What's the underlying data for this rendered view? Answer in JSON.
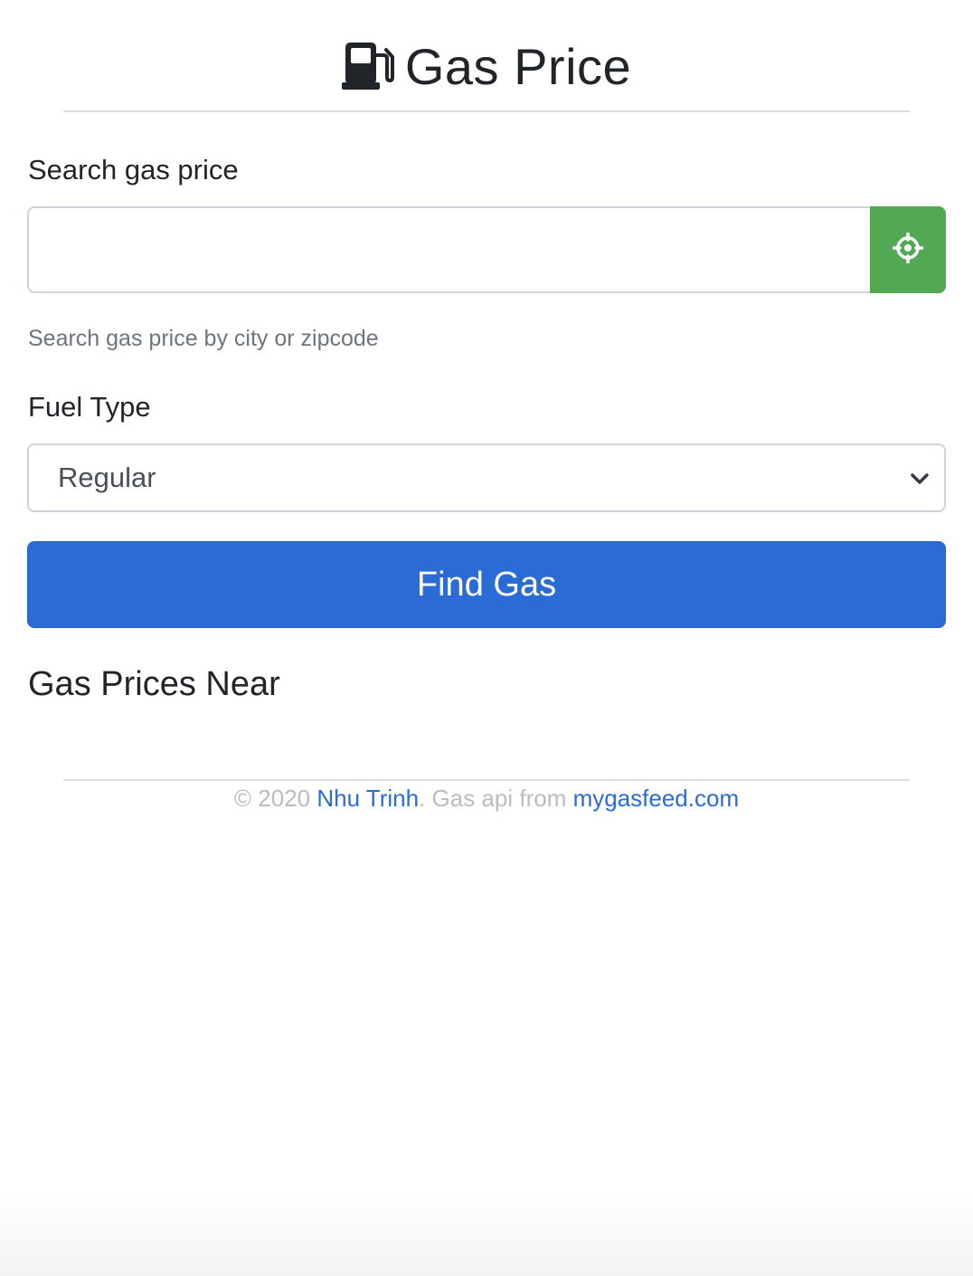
{
  "header": {
    "icon": "gas-pump-icon",
    "title": "Gas Price"
  },
  "search": {
    "label": "Search gas price",
    "value": "",
    "placeholder": "",
    "help_text": "Search gas price by city or zipcode",
    "locate_icon": "crosshairs-icon"
  },
  "fuel": {
    "label": "Fuel Type",
    "selected": "Regular"
  },
  "find_button": {
    "label": "Find Gas"
  },
  "results": {
    "heading": "Gas Prices Near"
  },
  "footer": {
    "prefix": "© 2020 ",
    "author": "Nhu Trinh",
    "middle": ". Gas api from ",
    "source": "mygasfeed.com"
  },
  "colors": {
    "primary": "#2b6bd6",
    "success": "#53a853",
    "muted": "#6c757d"
  }
}
